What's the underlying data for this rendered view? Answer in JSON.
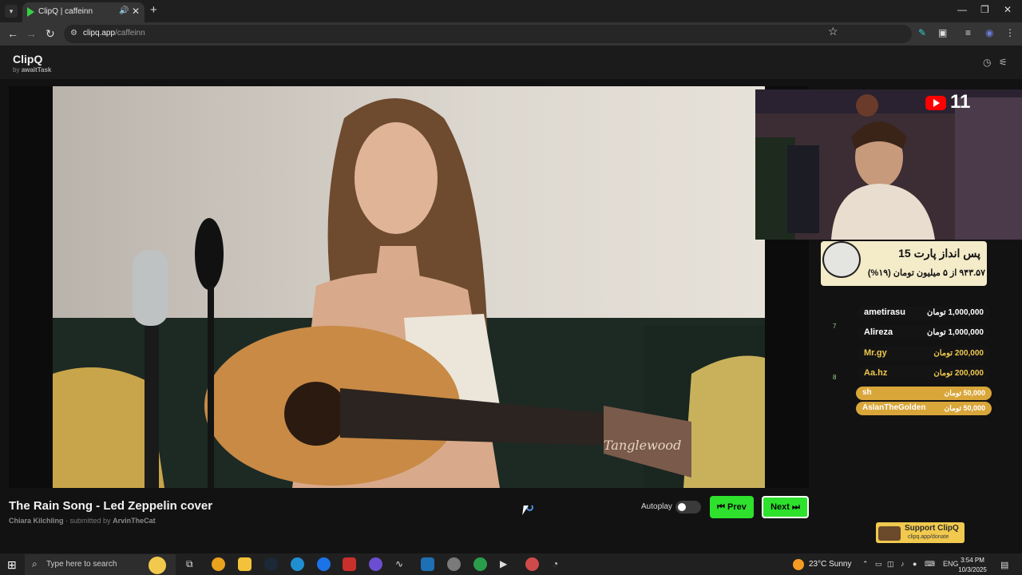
{
  "browser": {
    "tab_title": "ClipQ | caffeinn",
    "tab_audio_icon": "speaker-icon",
    "url_host": "clipq.app",
    "url_path": "/caffeinn",
    "window_controls": [
      "minimize",
      "restore",
      "close"
    ]
  },
  "app": {
    "brand": "ClipQ",
    "by_prefix": "by",
    "by_author": "awaitTask",
    "header_icons": [
      "history-icon",
      "settings-sliders-icon"
    ]
  },
  "overlay": {
    "youtube_count": "11",
    "goal_title": "پس انداز پارت 15",
    "goal_subtitle": "۹۴۳.۵۷ از ۵ میلیون تومان (۱۹%)",
    "donations": [
      {
        "name": "ametirasu",
        "amount": "1,000,000 تومان"
      },
      {
        "name": "Alireza",
        "amount": "1,000,000 تومان"
      },
      {
        "name": "Mr.gy",
        "amount": "200,000 تومان"
      },
      {
        "name": "Aa.hz",
        "amount": "200,000 تومان"
      },
      {
        "name": "sh",
        "amount": "50,000 تومان"
      },
      {
        "name": "AslanTheGolden",
        "amount": "50,000 تومان"
      }
    ],
    "ranks": [
      "7",
      "8"
    ]
  },
  "now_playing": {
    "title": "The Rain Song - Led Zeppelin cover",
    "artist": "Chiara Kilchling",
    "submitted_prefix": "· submitted by",
    "submitted_by": "ArvinTheCat"
  },
  "controls": {
    "autoplay_label": "Autoplay",
    "autoplay_on": false,
    "prev_label": "⏮ Prev",
    "next_label": "Next ⏭"
  },
  "support": {
    "title": "Support ClipQ",
    "url": "clipq.app/donate"
  },
  "taskbar": {
    "search_placeholder": "Type here to search",
    "weather": "23°C  Sunny",
    "language": "ENG",
    "time": "3:54 PM",
    "date": "10/3/2025"
  },
  "colors": {
    "accent_green": "#2de12d",
    "support_yellow": "#f0c94e",
    "goal_bg": "#f4ebc9"
  }
}
